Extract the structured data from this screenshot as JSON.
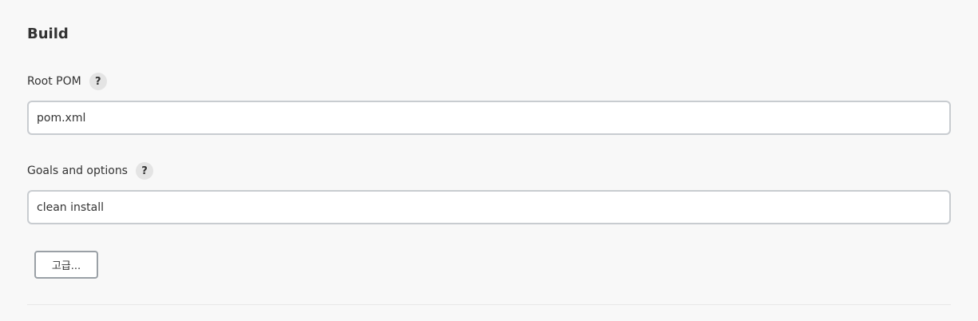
{
  "section": {
    "title": "Build"
  },
  "fields": {
    "root_pom": {
      "label": "Root POM",
      "help": "?",
      "value": "pom.xml"
    },
    "goals": {
      "label": "Goals and options",
      "help": "?",
      "value": "clean install"
    }
  },
  "advanced_button": {
    "label": "고급..."
  }
}
